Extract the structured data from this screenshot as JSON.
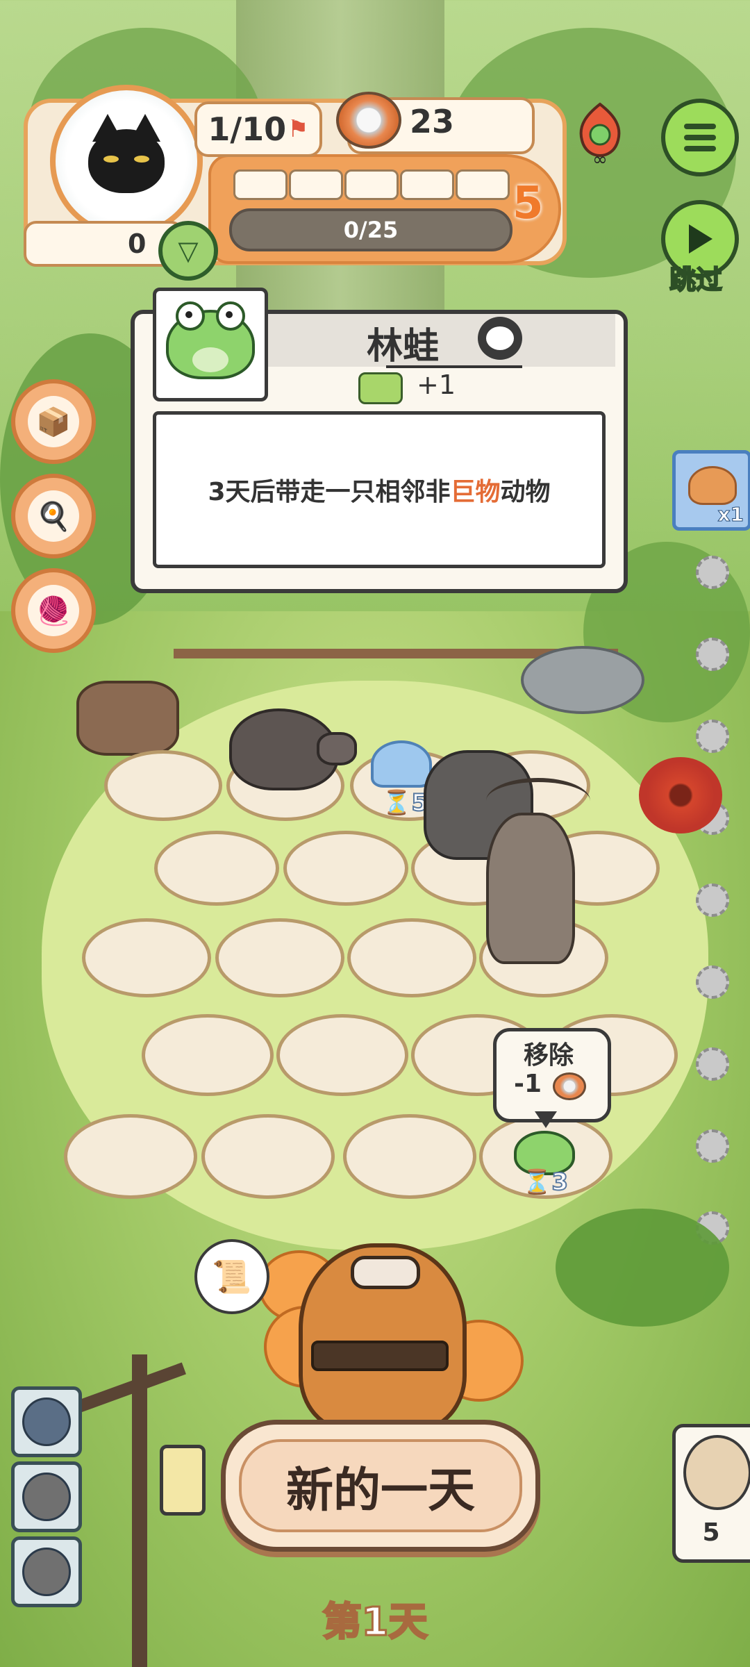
{
  "hud": {
    "stage_progress": "1/10",
    "cans": "23",
    "level": "5",
    "xp": "0/25",
    "score": "0",
    "xp_segments_filled": 0,
    "xp_segments_total": 5
  },
  "top_right": {
    "skip_label": "跳过"
  },
  "card": {
    "title": "林蛙",
    "bonus": "+1",
    "desc_prefix": "3天后带走一只相邻非",
    "desc_highlight": "巨物",
    "desc_suffix": "动物"
  },
  "side_item": {
    "count": "x1"
  },
  "board": {
    "jelly_timer": "5",
    "frog_timer": "3",
    "remove_label": "移除",
    "remove_cost": "-1"
  },
  "actions": {
    "new_day": "新的一天",
    "day": "第1天"
  },
  "owl": {
    "count": "5"
  },
  "colors": {
    "accent_orange": "#f07a2b",
    "highlight": "#e46c36",
    "menu_green": "#9ddc5b"
  }
}
